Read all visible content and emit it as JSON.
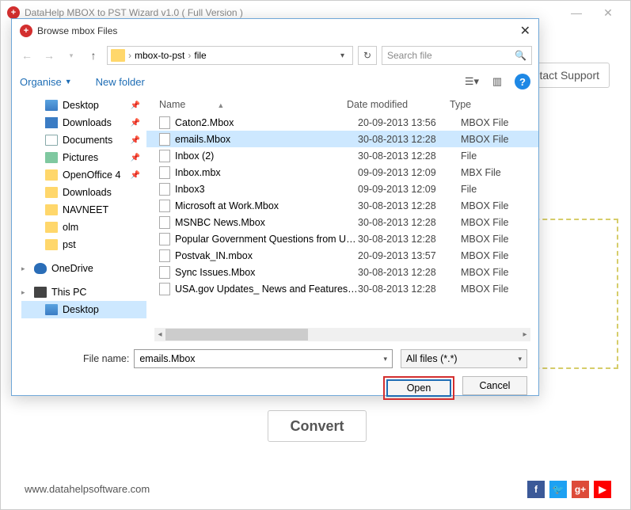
{
  "main_window": {
    "title": "DataHelp MBOX to PST Wizard v1.0 ( Full Version )",
    "minimize": "—",
    "close": "✕",
    "contact_support": "ontact Support",
    "convert": "Convert",
    "footer_url": "www.datahelpsoftware.com",
    "social": {
      "fb": "f",
      "tw": "t",
      "gp": "g+",
      "yt": "▶"
    }
  },
  "dialog": {
    "title": "Browse mbox Files",
    "breadcrumb": {
      "seg1": "mbox-to-pst",
      "seg2": "file"
    },
    "search_placeholder": "Search file",
    "toolbar": {
      "organise": "Organise",
      "new_folder": "New folder"
    },
    "tree": [
      {
        "label": "Desktop",
        "icon": "mon",
        "pin": true,
        "level": 1
      },
      {
        "label": "Downloads",
        "icon": "dl",
        "pin": true,
        "level": 1
      },
      {
        "label": "Documents",
        "icon": "doc",
        "pin": true,
        "level": 1
      },
      {
        "label": "Pictures",
        "icon": "pic",
        "pin": true,
        "level": 1
      },
      {
        "label": "OpenOffice 4",
        "icon": "fold",
        "pin": true,
        "level": 1
      },
      {
        "label": "Downloads",
        "icon": "fold",
        "pin": false,
        "level": 1
      },
      {
        "label": "NAVNEET",
        "icon": "fold",
        "pin": false,
        "level": 1
      },
      {
        "label": "olm",
        "icon": "fold",
        "pin": false,
        "level": 1
      },
      {
        "label": "pst",
        "icon": "fold",
        "pin": false,
        "level": 1
      },
      {
        "label": "OneDrive",
        "icon": "cloud",
        "pin": false,
        "level": 0,
        "gap": true
      },
      {
        "label": "This PC",
        "icon": "pc",
        "pin": false,
        "level": 0,
        "gap": true
      },
      {
        "label": "Desktop",
        "icon": "mon",
        "pin": false,
        "level": 1,
        "active": true
      }
    ],
    "columns": {
      "name": "Name",
      "date": "Date modified",
      "type": "Type"
    },
    "files": [
      {
        "name": "Caton2.Mbox",
        "date": "20-09-2013 13:56",
        "type": "MBOX File",
        "selected": false
      },
      {
        "name": "emails.Mbox",
        "date": "30-08-2013 12:28",
        "type": "MBOX File",
        "selected": true
      },
      {
        "name": "Inbox (2)",
        "date": "30-08-2013 12:28",
        "type": "File",
        "selected": false
      },
      {
        "name": "Inbox.mbx",
        "date": "09-09-2013 12:09",
        "type": "MBX File",
        "selected": false
      },
      {
        "name": "Inbox3",
        "date": "09-09-2013 12:09",
        "type": "File",
        "selected": false
      },
      {
        "name": "Microsoft at Work.Mbox",
        "date": "30-08-2013 12:28",
        "type": "MBOX File",
        "selected": false
      },
      {
        "name": "MSNBC News.Mbox",
        "date": "30-08-2013 12:28",
        "type": "MBOX File",
        "selected": false
      },
      {
        "name": "Popular Government Questions from US...",
        "date": "30-08-2013 12:28",
        "type": "MBOX File",
        "selected": false
      },
      {
        "name": "Postvak_IN.mbox",
        "date": "20-09-2013 13:57",
        "type": "MBOX File",
        "selected": false
      },
      {
        "name": "Sync Issues.Mbox",
        "date": "30-08-2013 12:28",
        "type": "MBOX File",
        "selected": false
      },
      {
        "name": "USA.gov Updates_ News and Features.M...",
        "date": "30-08-2013 12:28",
        "type": "MBOX File",
        "selected": false
      }
    ],
    "filename_label": "File name:",
    "filename_value": "emails.Mbox",
    "filetype_value": "All files (*.*)",
    "open": "Open",
    "cancel": "Cancel"
  }
}
